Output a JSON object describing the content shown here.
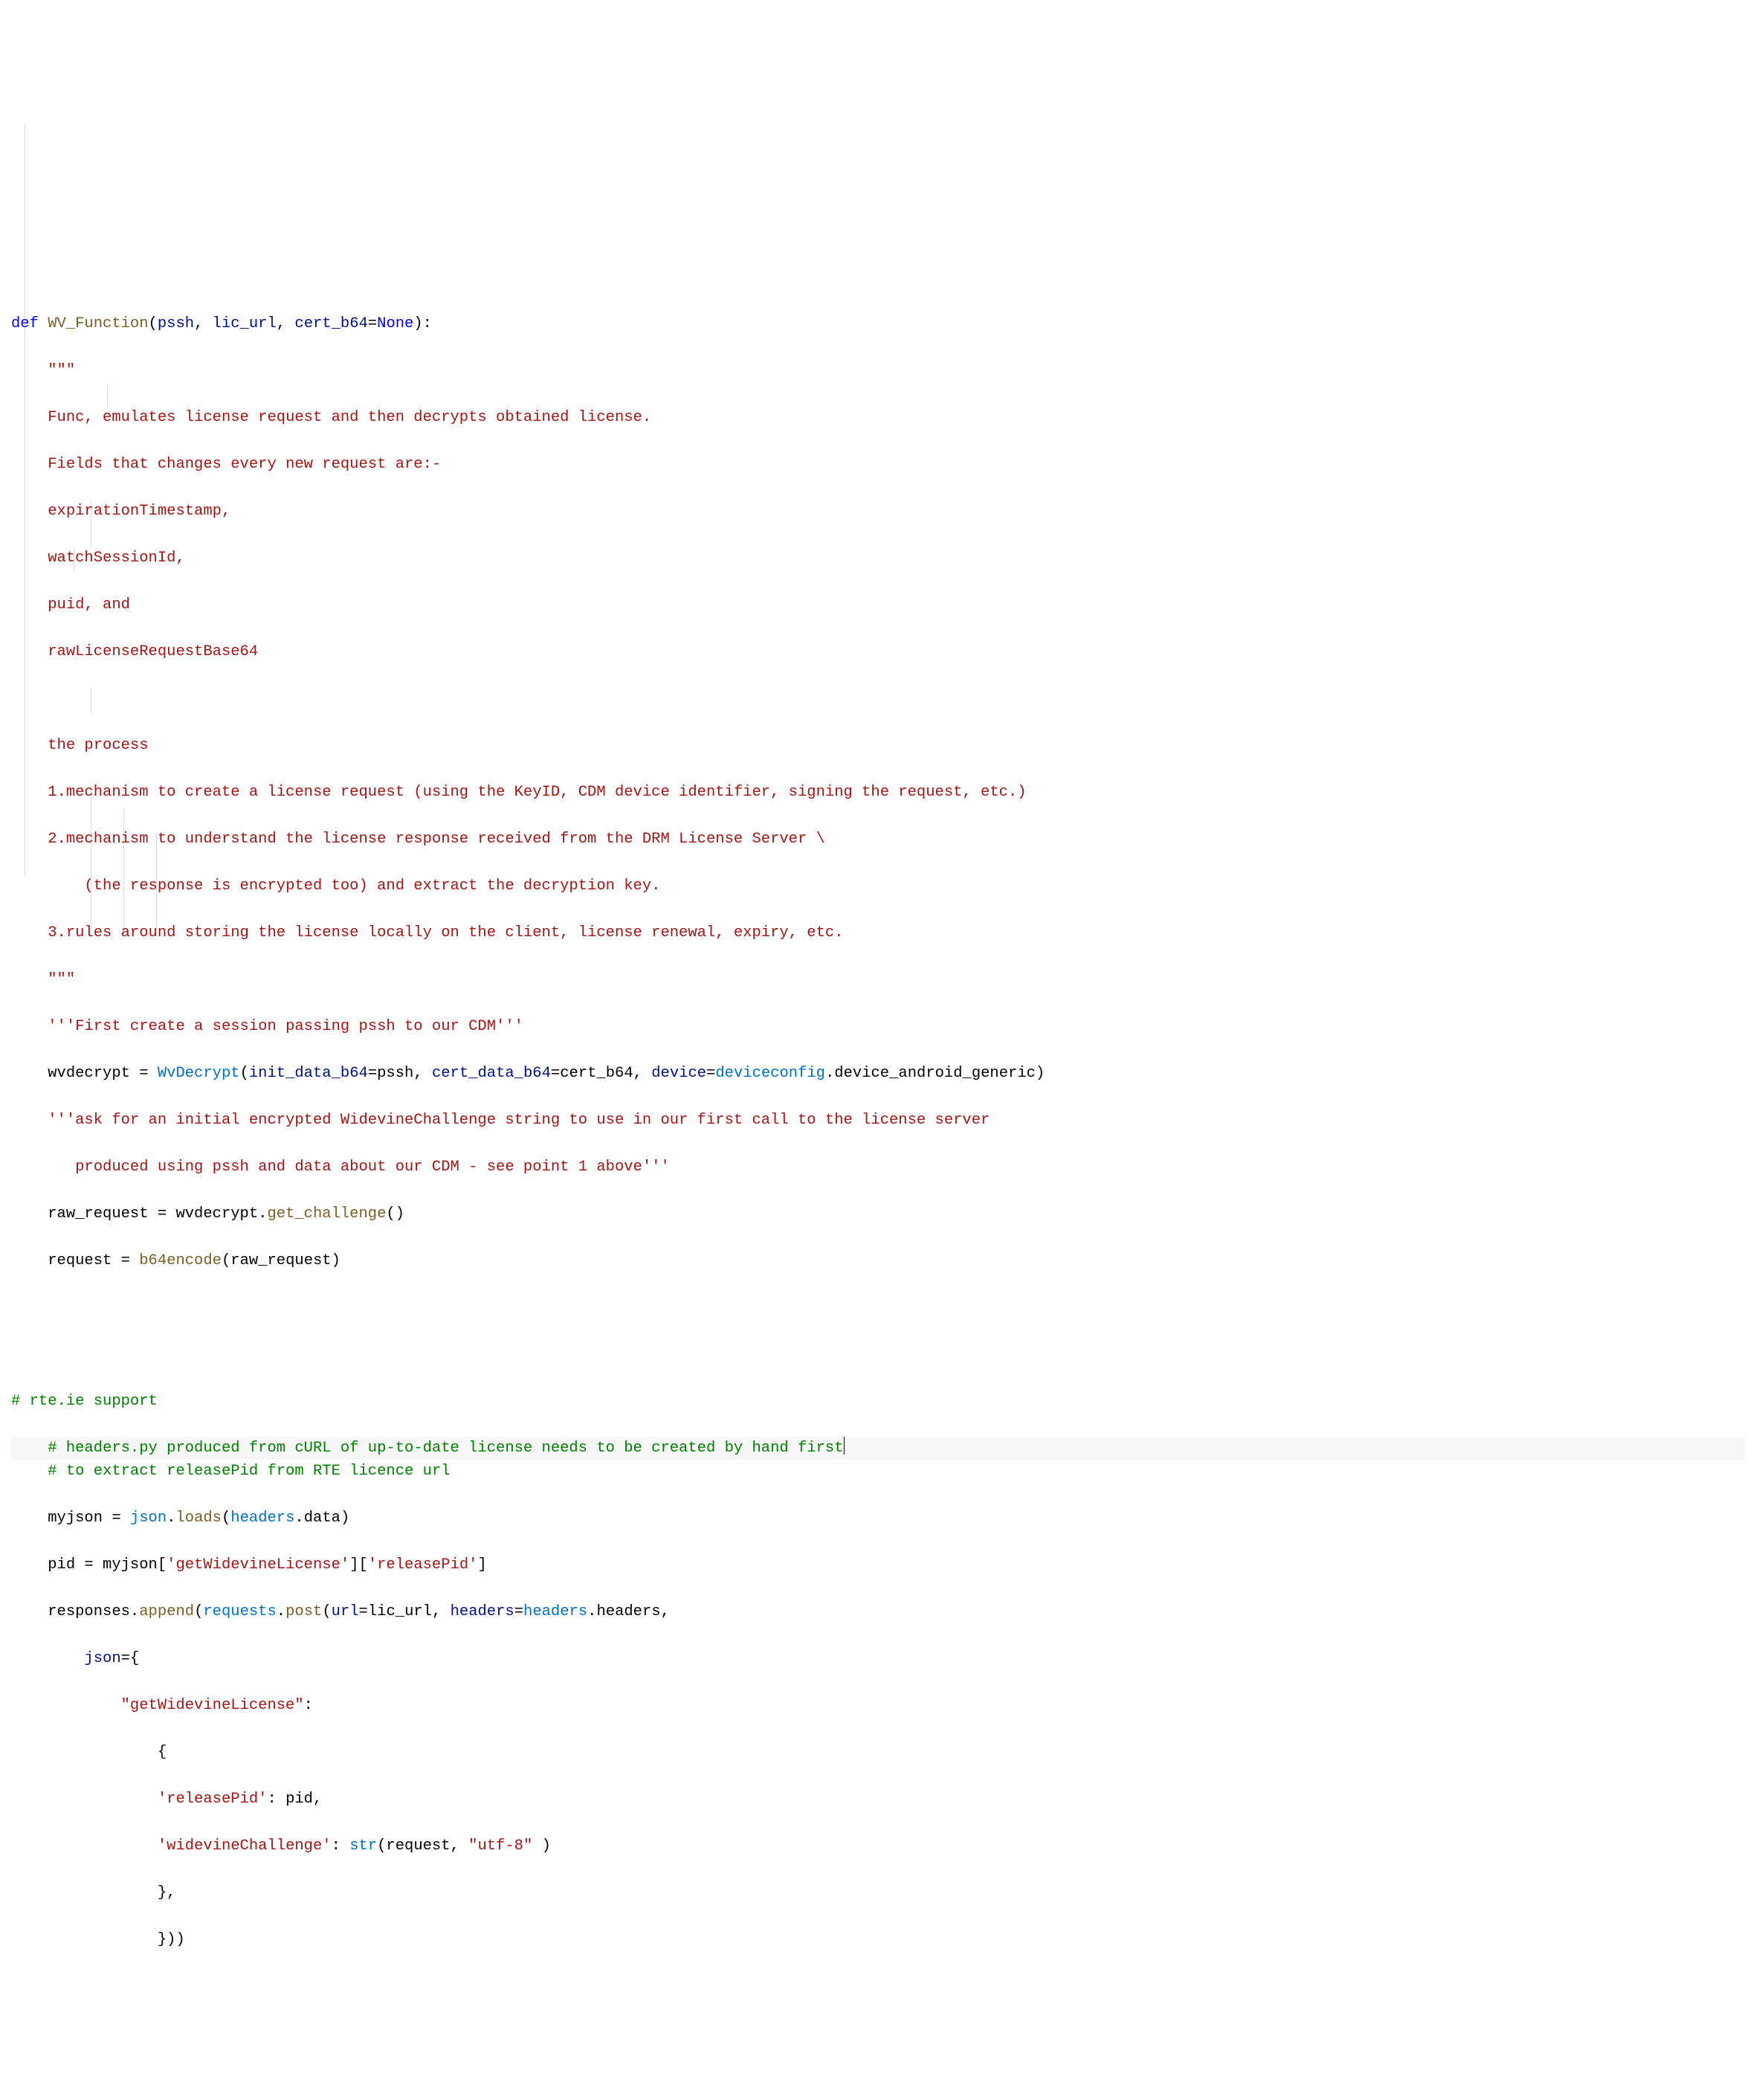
{
  "code": {
    "l1_def": "def",
    "l1_fn": " WV_Function",
    "l1_open": "(",
    "l1_p1": "pssh",
    "l1_c1": ", ",
    "l1_p2": "lic_url",
    "l1_c2": ", ",
    "l1_p3": "cert_b64",
    "l1_eq": "=",
    "l1_none": "None",
    "l1_close": "):",
    "l2_doc": "\"\"\"",
    "l3_doc": "Func, emulates license request and then decrypts obtained license.",
    "l4_doc": "Fields that changes every new request are:-",
    "l5_doc": "expirationTimestamp,",
    "l6_doc": "watchSessionId,",
    "l7_doc": "puid, and",
    "l8_doc": "rawLicenseRequestBase64",
    "l9_doc": "",
    "l10_doc": "the process",
    "l11_doc": "1.mechanism to create a license request (using the KeyID, CDM device identifier, signing the request, etc.)",
    "l12_doc": "2.mechanism to understand the license response received from the DRM License Server \\",
    "l13_doc": "    (the response is encrypted too) and extract the decryption key.",
    "l14_doc": "3.rules around storing the license locally on the client, license renewal, expiry, etc.",
    "l15_doc": "\"\"\"",
    "l16_str": "'''First create a session passing pssh to our CDM'''",
    "l17_a": "wvdecrypt = ",
    "l17_fn": "WvDecrypt",
    "l17_open": "(",
    "l17_p1": "init_data_b64",
    "l17_eq1": "=",
    "l17_v1": "pssh",
    "l17_c1": ", ",
    "l17_p2": "cert_data_b64",
    "l17_eq2": "=",
    "l17_v2": "cert_b64",
    "l17_c2": ", ",
    "l17_p3": "device",
    "l17_eq3": "=",
    "l17_v3a": "deviceconfig",
    "l17_dot": ".",
    "l17_v3b": "device_android_generic",
    "l17_close": ")",
    "l18_str": "'''ask for an initial encrypted WidevineChallenge string to use in our first call to the license server",
    "l19_str": "   produced using pssh and data about our CDM - see point 1 above'''",
    "l20_a": "raw_request = wvdecrypt.",
    "l20_fn": "get_challenge",
    "l20_par": "()",
    "l21_a": "request = ",
    "l21_fn": "b64encode",
    "l21_open": "(",
    "l21_v": "raw_request",
    "l21_close": ")",
    "l22": "",
    "l23": "",
    "l24_comment": "# rte.ie support",
    "l25_comment": "# headers.py produced from cURL of up-to-date license needs to be created by hand first",
    "l26_comment": "# to extract releasePid from RTE licence url",
    "l27_a": "myjson = ",
    "l27_mod": "json",
    "l27_dot": ".",
    "l27_fn": "loads",
    "l27_open": "(",
    "l27_mod2": "headers",
    "l27_dot2": ".",
    "l27_prop": "data",
    "l27_close": ")",
    "l28_a": "pid = myjson[",
    "l28_s1": "'getWidevineLicense'",
    "l28_b": "][",
    "l28_s2": "'releasePid'",
    "l28_c": "]",
    "l29_a": "responses.",
    "l29_fn": "append",
    "l29_open": "(",
    "l29_mod": "requests",
    "l29_dot": ".",
    "l29_fn2": "post",
    "l29_open2": "(",
    "l29_p1": "url",
    "l29_eq1": "=",
    "l29_v1": "lic_url",
    "l29_c1": ", ",
    "l29_p2": "headers",
    "l29_eq2": "=",
    "l29_mod2": "headers",
    "l29_dot2": ".",
    "l29_prop2": "headers",
    "l29_c2": ",",
    "l30_p": "json",
    "l30_eq": "=",
    "l30_brace": "{",
    "l31_key": "\"getWidevineLicense\"",
    "l31_colon": ":",
    "l32_brace": "{",
    "l33_key": "'releasePid'",
    "l33_colon": ": pid,",
    "l34_key": "'widevineChallenge'",
    "l34_colon": ": ",
    "l34_fn": "str",
    "l34_open": "(",
    "l34_v": "request",
    "l34_c": ", ",
    "l34_s": "\"utf-8\"",
    "l34_sp": " ",
    "l34_close": ")",
    "l35": "},",
    "l36": "}))"
  }
}
